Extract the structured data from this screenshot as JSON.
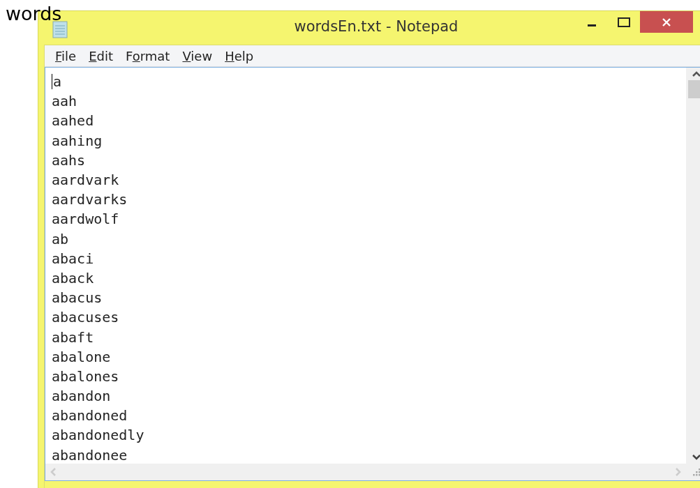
{
  "caption": "words",
  "window": {
    "title": "wordsEn.txt - Notepad"
  },
  "menu": [
    {
      "key": "F",
      "after": "ile"
    },
    {
      "key": "E",
      "after": "dit"
    },
    {
      "before": "F",
      "key": "o",
      "after": "rmat"
    },
    {
      "key": "V",
      "after": "iew"
    },
    {
      "key": "H",
      "after": "elp"
    }
  ],
  "lines": [
    "a",
    "aah",
    "aahed",
    "aahing",
    "aahs",
    "aardvark",
    "aardvarks",
    "aardwolf",
    "ab",
    "abaci",
    "aback",
    "abacus",
    "abacuses",
    "abaft",
    "abalone",
    "abalones",
    "abandon",
    "abandoned",
    "abandonedly",
    "abandonee"
  ]
}
